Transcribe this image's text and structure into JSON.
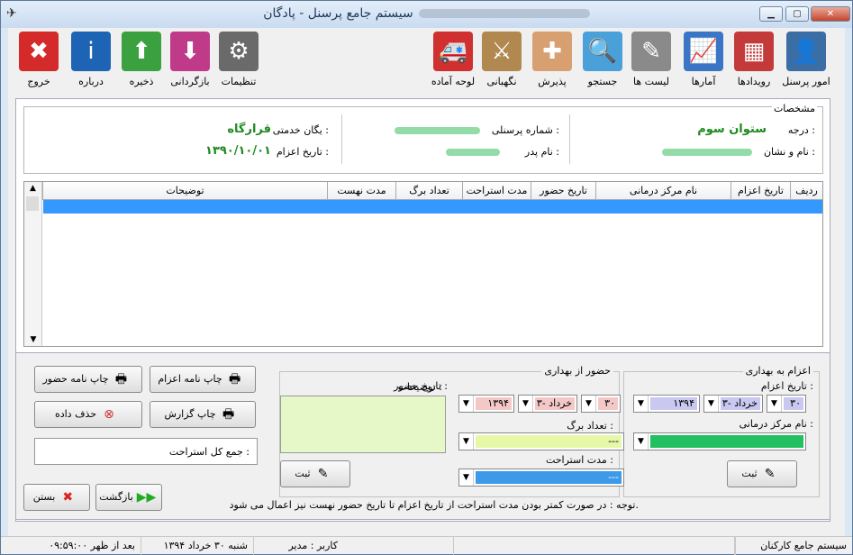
{
  "window": {
    "title": "سیستم جامع پرسنل - پادگان"
  },
  "toolbar": [
    {
      "key": "personnel",
      "label": "امور پرسنل",
      "color": "#3a6ea5",
      "glyph": "👤"
    },
    {
      "key": "events",
      "label": "رویدادها",
      "color": "#c43a3a",
      "glyph": "▦"
    },
    {
      "key": "stats",
      "label": "آمارها",
      "color": "#3b76c6",
      "glyph": "📈"
    },
    {
      "key": "lists",
      "label": "لیست ها",
      "color": "#8a8a8a",
      "glyph": "✎"
    },
    {
      "key": "search",
      "label": "جستجو",
      "color": "#4aa0d8",
      "glyph": "🔍"
    },
    {
      "key": "reception",
      "label": "پذیرش",
      "color": "#d8a070",
      "glyph": "✚"
    },
    {
      "key": "guard",
      "label": "نگهبانی",
      "color": "#b08850",
      "glyph": "⚔"
    },
    {
      "key": "ready",
      "label": "لوحه آماده",
      "color": "#d03030",
      "glyph": "🚑"
    },
    {
      "key": "settings",
      "label": "تنظیمات",
      "color": "#6a6a6a",
      "glyph": "⚙"
    },
    {
      "key": "restore",
      "label": "بازگردانی",
      "color": "#c03a8a",
      "glyph": "⬇"
    },
    {
      "key": "save",
      "label": "ذخیره",
      "color": "#3aa040",
      "glyph": "⬆"
    },
    {
      "key": "about",
      "label": "درباره",
      "color": "#1e64b4",
      "glyph": "i"
    },
    {
      "key": "exit",
      "label": "خروج",
      "color": "#d52a2a",
      "glyph": "✖"
    }
  ],
  "specs": {
    "title": "مشخصات",
    "rank_label": "درجه :",
    "rank_value": "ستوان سوم",
    "name_label": "نام و نشان :",
    "pid_label": "شماره پرسنلی :",
    "father_label": "نام پدر :",
    "unit_label": "یگان خدمتی :",
    "unit_value": "قرارگاه",
    "dispatch_label": "تاریخ اعزام :",
    "dispatch_value": "۱۳۹۰/۱۰/۰۱"
  },
  "grid": {
    "columns": [
      "ردیف",
      "تاریخ اعزام",
      "نام مرکز درمانی",
      "تاریخ حضور",
      "مدت استراحت",
      "تعداد برگ",
      "مدت نهست",
      "توضیحات"
    ]
  },
  "send": {
    "legend": "اعزام به بهداری",
    "date_label": "تاریخ اعزام :",
    "day": "۳۰",
    "month": "۳- خرداد",
    "year": "۱۳۹۴",
    "center_label": "نام مرکز درمانی :",
    "submit": "ثبت"
  },
  "attend": {
    "legend": "حضور از بهداری",
    "date_label": "تاریخ حضور :",
    "day": "۳۰",
    "month": "۳- خرداد",
    "year": "۱۳۹۴",
    "sheets_label": "تعداد برگ :",
    "sheets_value": "---",
    "rest_label": "مدت استراحت :",
    "rest_value": "---",
    "desc_label": "توضیحات :",
    "submit": "ثبت"
  },
  "note": "توجه : در صورت کمتر بودن مدت استراحت از تاریخ اعزام تا تاریخ حضور نهست نیز اعمال می شود.",
  "actions": {
    "print_dispatch": "چاپ نامه اعزام",
    "print_attend": "چاپ نامه حضور",
    "print_report": "چاپ گزارش",
    "delete": "حذف داده",
    "total_rest": "جمع کل استراحت :",
    "back": "بازگشت",
    "close": "بستن"
  },
  "status": {
    "system": "سیستم جامع کارکنان",
    "user": "کاربر : مدیر",
    "date": "شنبه ۳۰ خرداد ۱۳۹۴",
    "time": "۰۹:۵۹:۰۰ بعد از ظهر"
  }
}
